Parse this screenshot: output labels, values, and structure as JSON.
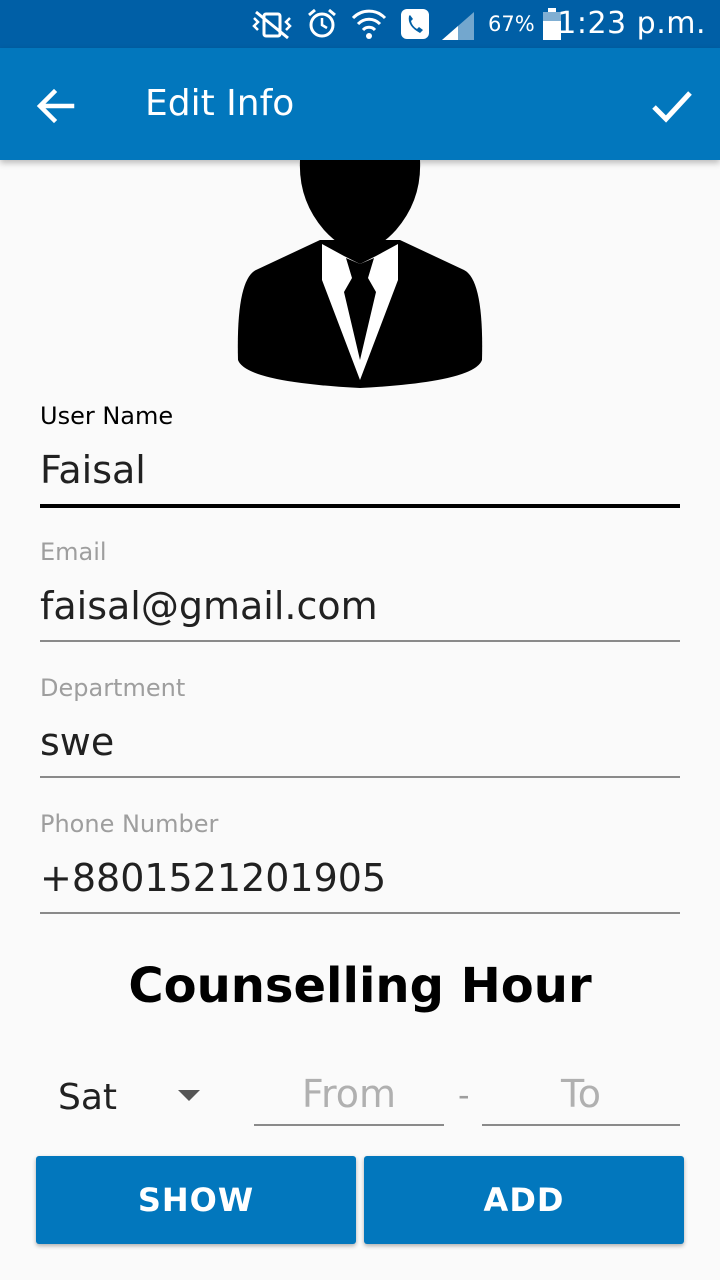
{
  "status_bar": {
    "battery_percent": "67%",
    "time": "1:23 p.m."
  },
  "app_bar": {
    "title": "Edit Info"
  },
  "form": {
    "user_name": {
      "label": "User Name",
      "value": "Faisal"
    },
    "email": {
      "label": "Email",
      "value": "faisal@gmail.com"
    },
    "department": {
      "label": "Department",
      "value": "swe"
    },
    "phone": {
      "label": "Phone Number",
      "value": "+8801521201905"
    }
  },
  "counselling": {
    "title": "Counselling Hour",
    "day": "Sat",
    "from_placeholder": "From",
    "separator": "-",
    "to_placeholder": "To",
    "show_label": "SHOW",
    "add_label": "ADD"
  },
  "colors": {
    "primary": "#0277bd",
    "status_bar": "#005fa6",
    "background": "#fafafa"
  }
}
